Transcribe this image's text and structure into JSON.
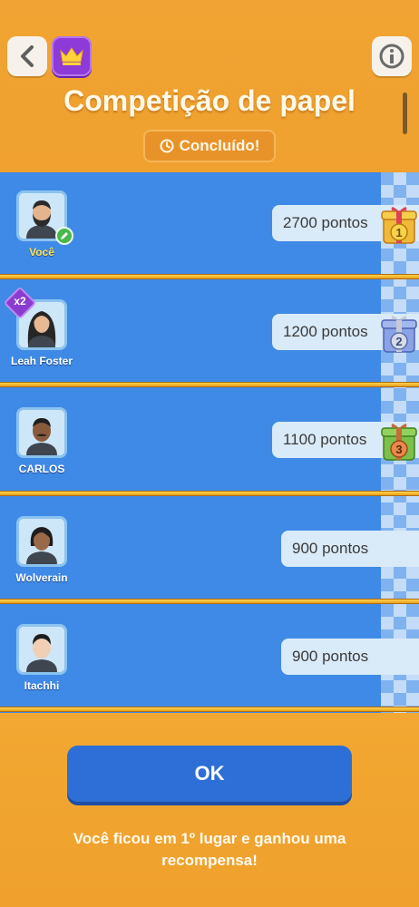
{
  "header": {
    "title": "Competição de papel",
    "status": "Concluído!",
    "icons": [
      "back-icon",
      "crown-icon",
      "info-icon",
      "clock-icon"
    ]
  },
  "players": [
    {
      "name": "Você",
      "score": "2700 pontos",
      "rank": "1",
      "gift_color": "#f2c44a",
      "is_me": true
    },
    {
      "name": "Leah Foster",
      "score": "1200 pontos",
      "rank": "2",
      "gift_color": "#8aa2e6",
      "is_me": false,
      "multiplier": "x2"
    },
    {
      "name": "CARLOS",
      "score": "1100 pontos",
      "rank": "3",
      "gift_color": "#7cc04a",
      "is_me": false
    },
    {
      "name": "Wolverain",
      "score": "900 pontos",
      "is_me": false
    },
    {
      "name": "Itachhi",
      "score": "900 pontos",
      "is_me": false
    }
  ],
  "footer": {
    "ok_label": "OK",
    "message": "Você ficou em 1º lugar e ganhou uma recompensa!"
  },
  "colors": {
    "background": "#f2a832",
    "board": "#3f8ae6",
    "ok_button": "#2d6fd6",
    "me_name": "#ffe34a"
  }
}
